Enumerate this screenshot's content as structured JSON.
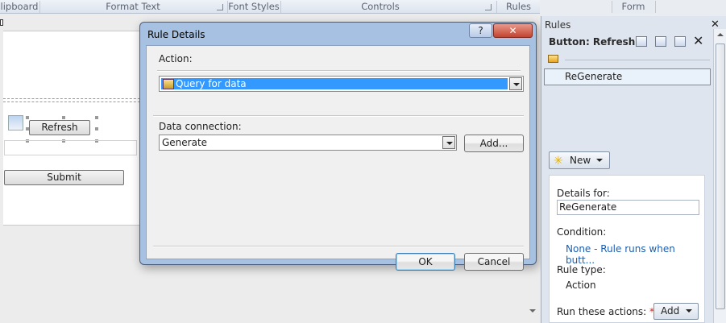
{
  "ribbon": {
    "groups": [
      "lipboard",
      "Format Text",
      "Font Styles",
      "Controls",
      "Rules",
      "Form"
    ]
  },
  "form": {
    "refresh_label": "Refresh",
    "submit_label": "Submit"
  },
  "dialog": {
    "title": "Rule Details",
    "help_label": "?",
    "close_label": "✕",
    "action_label": "Action:",
    "action_value": "Query for data",
    "connection_label": "Data connection:",
    "connection_value": "Generate",
    "add_label": "Add...",
    "ok_label": "OK",
    "cancel_label": "Cancel"
  },
  "rules_pane": {
    "title": "Rules",
    "close_label": "✕",
    "subtitle": "Button: Refresh",
    "rule_item": "ReGenerate",
    "new_label": "New",
    "details_for_label": "Details for:",
    "details_for_value": "ReGenerate",
    "condition_label": "Condition:",
    "condition_value": "None - Rule runs when butt...",
    "rule_type_label": "Rule type:",
    "rule_type_value": "Action",
    "run_actions_label": "Run these actions:",
    "required_mark": "*",
    "add_label": "Add"
  },
  "colors": {
    "link": "#1a5fb4",
    "selection": "#3399ff",
    "required": "#d02020"
  }
}
